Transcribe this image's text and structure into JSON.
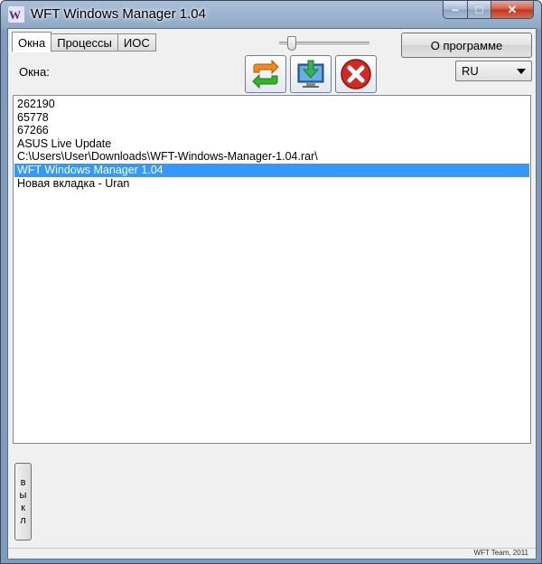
{
  "window": {
    "title": "WFT Windows Manager 1.04",
    "controls": {
      "minimize": "–",
      "maximize": "□",
      "close": "✕"
    }
  },
  "tabs": [
    {
      "label": "Окна",
      "active": true
    },
    {
      "label": "Процессы",
      "active": false
    },
    {
      "label": "ИОС",
      "active": false
    }
  ],
  "about_button": "О программе",
  "windows_label": "Окна:",
  "toolbar": {
    "refresh": "refresh-icon",
    "download": "download-monitor-icon",
    "close": "close-icon"
  },
  "language_select": {
    "value": "RU"
  },
  "window_list": [
    {
      "text": "262190",
      "selected": false
    },
    {
      "text": "65778",
      "selected": false
    },
    {
      "text": "67266",
      "selected": false
    },
    {
      "text": "ASUS Live Update",
      "selected": false
    },
    {
      "text": "C:\\Users\\User\\Downloads\\WFT-Windows-Manager-1.04.rar\\",
      "selected": false
    },
    {
      "text": "WFT Windows Manager 1.04",
      "selected": true
    },
    {
      "text": "Новая вкладка - Uran",
      "selected": false
    }
  ],
  "toggle_button": [
    "в",
    "ы",
    "к",
    "л"
  ],
  "footer": "WFT Team, 2011",
  "colors": {
    "selection": "#3399ff",
    "close_red": "#d12b1f"
  }
}
